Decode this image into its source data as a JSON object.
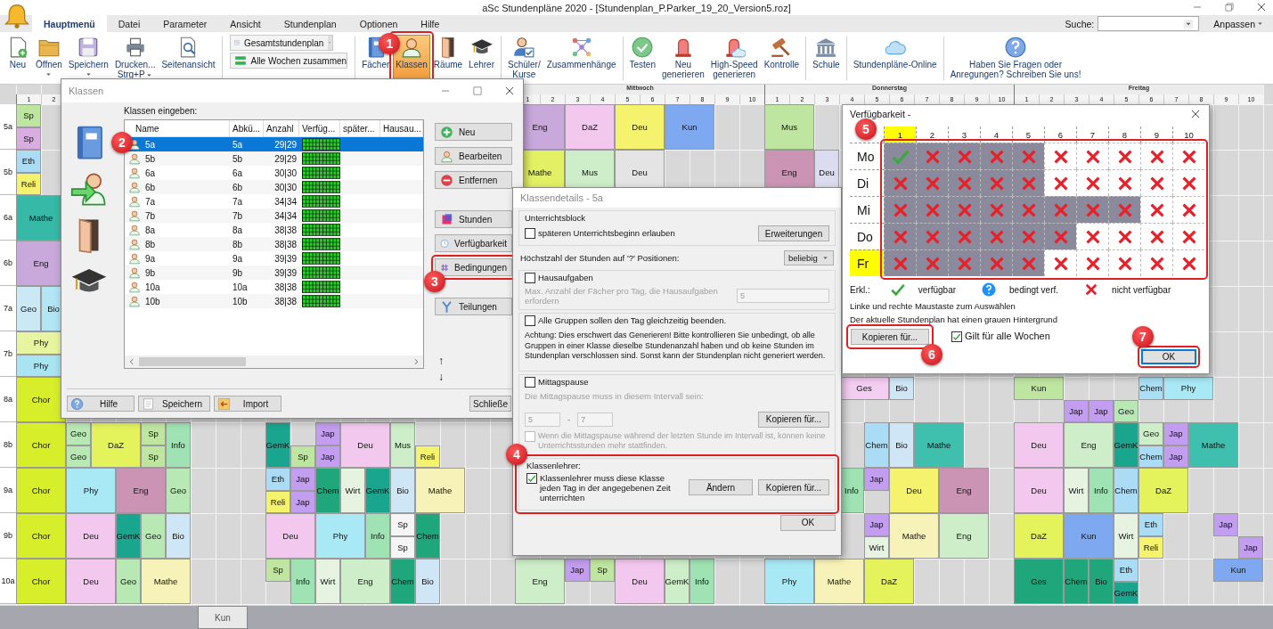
{
  "window": {
    "title": "aSc Stundenpläne 2020  - [Stundenplan_P.Parker_19_20_Version5.roz]"
  },
  "menu_tabs": [
    {
      "label": "Hauptmenü",
      "selected": true
    },
    {
      "label": "Datei",
      "selected": false
    },
    {
      "label": "Parameter",
      "selected": false
    },
    {
      "label": "Ansicht",
      "selected": false
    },
    {
      "label": "Stundenplan",
      "selected": false
    },
    {
      "label": "Optionen",
      "selected": false
    },
    {
      "label": "Hilfe",
      "selected": false
    }
  ],
  "search": {
    "label": "Suche:"
  },
  "customize": {
    "label": "Anpassen"
  },
  "ribbon": [
    {
      "items": [
        {
          "kind": "button",
          "label": "Neu",
          "selected": false,
          "has_dropdown": false
        },
        {
          "kind": "button",
          "label": "Öffnen",
          "selected": false,
          "has_dropdown": true
        },
        {
          "kind": "button",
          "label": "Speichern",
          "selected": false,
          "has_dropdown": true
        },
        {
          "kind": "button",
          "label": "Drucken...\nStrg+P",
          "selected": false,
          "has_dropdown": true
        },
        {
          "kind": "button",
          "label": "Seitenansicht",
          "selected": false,
          "has_dropdown": false
        }
      ]
    },
    {
      "items": [
        {
          "kind": "dropdown",
          "label": "Gesamtstundenplan",
          "selected": false,
          "has_dropdown": true
        },
        {
          "kind": "wide",
          "label": "Alle Wochen zusammen",
          "selected": false,
          "has_dropdown": false
        }
      ]
    },
    {
      "items": [
        {
          "kind": "button",
          "label": "Fächer",
          "selected": false,
          "has_dropdown": false
        },
        {
          "kind": "button",
          "label": "Klassen",
          "selected": true,
          "has_dropdown": false,
          "callout": {
            "label": "1",
            "framed": true
          }
        },
        {
          "kind": "button",
          "label": "Räume",
          "selected": false,
          "has_dropdown": false
        },
        {
          "kind": "button",
          "label": "Lehrer",
          "selected": false,
          "has_dropdown": false
        }
      ]
    },
    {
      "items": [
        {
          "kind": "button",
          "label": "Schüler/\nKurse",
          "selected": false,
          "has_dropdown": false
        },
        {
          "kind": "button",
          "label": "Zusammenhänge",
          "selected": false,
          "has_dropdown": false
        }
      ]
    },
    {
      "items": [
        {
          "kind": "button",
          "label": "Testen",
          "selected": false,
          "has_dropdown": false
        },
        {
          "kind": "button",
          "label": "Neu\ngenerieren",
          "selected": false,
          "has_dropdown": false
        },
        {
          "kind": "button",
          "label": "High-Speed\ngenerieren",
          "selected": false,
          "has_dropdown": false
        },
        {
          "kind": "button",
          "label": "Kontrolle",
          "selected": false,
          "has_dropdown": false
        }
      ]
    },
    {
      "items": [
        {
          "kind": "button",
          "label": "Schule",
          "selected": false,
          "has_dropdown": false
        }
      ]
    },
    {
      "items": [
        {
          "kind": "button",
          "label": "Stundenpläne-Online",
          "selected": false,
          "has_dropdown": false
        }
      ]
    },
    {
      "items": [
        {
          "kind": "button",
          "label": "Haben Sie Fragen oder\nAnregungen? Schreiben Sie uns!",
          "selected": false,
          "has_dropdown": false
        }
      ]
    }
  ],
  "timetable": {
    "days": [
      {
        "kind": "shown",
        "periods": [
          "1",
          "2"
        ]
      },
      {
        "kind": "covered"
      },
      {
        "kind": "shown",
        "name": "Mittwoch",
        "periods": [
          "1",
          "2",
          "3",
          "4",
          "5",
          "6",
          "7",
          "8",
          "9",
          "10"
        ]
      },
      {
        "kind": "shown",
        "name": "Donnerstag",
        "periods": [
          "1",
          "2",
          "3",
          "4",
          "5",
          "6",
          "7",
          "8",
          "9",
          "10"
        ]
      },
      {
        "kind": "shown",
        "name": "Freitag",
        "periods": [
          "1",
          "2",
          "3",
          "4",
          "5",
          "6",
          "7",
          "8",
          "9",
          "10"
        ]
      }
    ],
    "rows": [
      {
        "label": "5a",
        "cells": [
          {
            "kind": "split",
            "top": {
              "subject": "Sp",
              "color": "#bfe6a0"
            },
            "bottom": {
              "subject": "Sp",
              "color": "#d8aee0"
            }
          },
          "",
          "",
          "",
          "",
          "",
          "",
          "",
          "",
          "",
          "",
          "",
          "",
          "",
          "",
          "",
          "",
          "",
          "",
          "",
          {
            "kind": "double",
            "subject": "Eng",
            "color": "#c9a8dc"
          },
          "",
          {
            "kind": "double",
            "subject": "DaZ",
            "color": "#f3c8ee"
          },
          "",
          {
            "kind": "double",
            "subject": "Deu",
            "color": "#f5f26e"
          },
          "",
          {
            "kind": "double",
            "subject": "Kun",
            "color": "#7ea8ef"
          },
          "",
          "",
          "",
          {
            "kind": "double",
            "subject": "Mus",
            "color": "#bfe6a1"
          }
        ]
      },
      {
        "label": "5b",
        "cells": [
          {
            "kind": "split",
            "top": {
              "subject": "Eth",
              "color": "#aadcf5"
            },
            "bottom": {
              "subject": "Reli",
              "color": "#f5f26e"
            }
          },
          "",
          "",
          "",
          "",
          "",
          "",
          "",
          "",
          "",
          "",
          "",
          "",
          "",
          "",
          "",
          "",
          "",
          "",
          "",
          {
            "kind": "double",
            "subject": "Mathe",
            "color": "#e2f064"
          },
          "",
          {
            "kind": "double",
            "subject": "Mus",
            "color": "#cdeec8"
          },
          "",
          {
            "kind": "double",
            "subject": "Deu",
            "color": "#e4e4e4"
          },
          "",
          "",
          "",
          "",
          "",
          {
            "kind": "double",
            "subject": "Eng",
            "color": "#cc94b4"
          },
          "",
          {
            "kind": "single",
            "subject": "Deu",
            "color": "#dcdcf0"
          }
        ]
      },
      {
        "label": "6a",
        "cells": [
          {
            "kind": "double",
            "subject": "Mathe",
            "color": "#36b9a6"
          }
        ]
      },
      {
        "label": "6b",
        "cells": [
          {
            "kind": "double",
            "subject": "Eng",
            "color": "#c9a8dc"
          }
        ]
      },
      {
        "label": "7a",
        "cells": [
          {
            "kind": "single",
            "subject": "Geo",
            "color": "#cbe9f5"
          },
          {
            "kind": "single",
            "subject": "Bio",
            "color": "#b2e6f5"
          }
        ]
      },
      {
        "label": "7b",
        "cells": [
          {
            "kind": "double_split",
            "top": {
              "subject": "Phy",
              "color": "#e8f5a0"
            },
            "bottom": {
              "subject": "Phy",
              "color": "#a8e4f2"
            }
          }
        ]
      },
      {
        "label": "8a",
        "cells": [
          {
            "kind": "double",
            "subject": "Chor",
            "color": "#d6ef2a"
          },
          "",
          "",
          "",
          "",
          "",
          "",
          "",
          "",
          "",
          "",
          "",
          "",
          "",
          "",
          "",
          "",
          "",
          "",
          "",
          "",
          "",
          "",
          "",
          "",
          "",
          "",
          "",
          "",
          "",
          "",
          "",
          "",
          {
            "kind": "double_split",
            "top": {
              "subject": "Ges",
              "color": "#f4cdf2"
            }
          },
          "",
          {
            "kind": "split",
            "top": {
              "subject": "Bio",
              "color": "#cfe6f7"
            }
          },
          "",
          "",
          "",
          "",
          {
            "kind": "double_split",
            "top": {
              "subject": "Kun",
              "color": "#bfe6a0"
            }
          },
          "",
          {
            "kind": "split",
            "bottom": {
              "subject": "Jap",
              "color": "#c39df0"
            }
          },
          {
            "kind": "split",
            "bottom": {
              "subject": "Jap",
              "color": "#c39df0"
            }
          },
          {
            "kind": "split",
            "bottom": {
              "subject": "Geo",
              "color": "#b8e9b5"
            }
          },
          {
            "kind": "split",
            "top": {
              "subject": "Chem",
              "color": "#a9e0f5"
            }
          },
          {
            "kind": "double_split",
            "top": {
              "subject": "Phy",
              "color": "#a9e8f5"
            }
          }
        ]
      },
      {
        "label": "8b",
        "cells": [
          {
            "kind": "double",
            "subject": "Chor",
            "color": "#d6ef2a"
          },
          "",
          {
            "kind": "split",
            "top": {
              "subject": "Geo",
              "color": "#b8e9b5"
            },
            "bottom": {
              "subject": "Geo",
              "color": "#b8e9b5"
            }
          },
          {
            "kind": "double",
            "subject": "DaZ",
            "color": "#e4f25c"
          },
          "",
          {
            "kind": "split",
            "top": {
              "subject": "Sp",
              "color": "#bfe6a0"
            },
            "bottom": {
              "subject": "Sp",
              "color": "#bfe6a0"
            }
          },
          {
            "kind": "single",
            "subject": "Info",
            "color": "#9fe3b4"
          },
          "",
          "",
          "",
          {
            "kind": "single",
            "subject": "GemK",
            "color": "#1aa58e"
          },
          {
            "kind": "split",
            "bottom": {
              "subject": "Sp",
              "color": "#bfe6a0"
            }
          },
          {
            "kind": "split",
            "top": {
              "subject": "Jap",
              "color": "#c39df0"
            },
            "bottom": {
              "subject": "Jap",
              "color": "#c39df0"
            }
          },
          {
            "kind": "double",
            "subject": "Deu",
            "color": "#f3c8ee"
          },
          "",
          {
            "kind": "single",
            "subject": "Mus",
            "color": "#cdeec8"
          },
          {
            "kind": "split",
            "bottom": {
              "subject": "Reli",
              "color": "#f5f26e"
            }
          },
          "",
          "",
          "",
          "",
          "",
          "",
          "",
          "",
          "",
          "",
          "",
          "",
          "",
          "",
          "",
          "",
          "",
          {
            "kind": "single",
            "subject": "Chem",
            "color": "#aadcf5"
          },
          {
            "kind": "single",
            "subject": "Bio",
            "color": "#cfe6f7"
          },
          {
            "kind": "double",
            "subject": "Mathe",
            "color": "#3fbfae"
          },
          "",
          "",
          "",
          {
            "kind": "double",
            "subject": "Deu",
            "color": "#f3c8ee"
          },
          "",
          {
            "kind": "double",
            "subject": "Eng",
            "color": "#cdeec8"
          },
          "",
          {
            "kind": "single",
            "subject": "GemK",
            "color": "#1aa58e"
          },
          {
            "kind": "split",
            "top": {
              "subject": "Geo",
              "color": "#cdeec8"
            },
            "bottom": {
              "subject": "Chem",
              "color": "#aadcf5"
            }
          },
          {
            "kind": "split",
            "top": {
              "subject": "Jap",
              "color": "#c39df0"
            },
            "bottom": {
              "subject": "Jap",
              "color": "#c39df0"
            }
          },
          {
            "kind": "double",
            "subject": "Mathe",
            "color": "#3fbfae"
          }
        ]
      },
      {
        "label": "9a",
        "cells": [
          {
            "kind": "double",
            "subject": "Chor",
            "color": "#d6ef2a"
          },
          "",
          {
            "kind": "double",
            "subject": "Phy",
            "color": "#a9e8f5"
          },
          "",
          {
            "kind": "double",
            "subject": "Eng",
            "color": "#cc94b4"
          },
          "",
          {
            "kind": "single",
            "subject": "Geo",
            "color": "#b8e9b5"
          },
          "",
          "",
          "",
          {
            "kind": "split",
            "top": {
              "subject": "Eth",
              "color": "#aadcf5"
            },
            "bottom": {
              "subject": "Reli",
              "color": "#f5f26e"
            }
          },
          {
            "kind": "split",
            "top": {
              "subject": "Jap",
              "color": "#c39df0"
            },
            "bottom": {
              "subject": "Jap",
              "color": "#c39df0"
            }
          },
          {
            "kind": "single",
            "subject": "Chem",
            "color": "#1fa67a"
          },
          {
            "kind": "single",
            "subject": "Wirt",
            "color": "#e5f3e0"
          },
          {
            "kind": "single",
            "subject": "GemK",
            "color": "#1aa58e"
          },
          {
            "kind": "single",
            "subject": "Bio",
            "color": "#cfe6f7"
          },
          {
            "kind": "double",
            "subject": "Mathe",
            "color": "#f7f3b8"
          },
          "",
          "",
          "",
          "",
          "",
          "",
          "",
          "",
          "",
          "",
          "",
          "",
          "",
          "",
          "",
          "",
          {
            "kind": "single",
            "subject": "Info",
            "color": "#9fe3b4"
          },
          {
            "kind": "split",
            "top": {
              "subject": "Jap",
              "color": "#c39df0"
            }
          },
          {
            "kind": "double",
            "subject": "Deu",
            "color": "#f5f26e"
          },
          "",
          {
            "kind": "double",
            "subject": "Eng",
            "color": "#cc94b4"
          },
          "",
          "",
          {
            "kind": "double",
            "subject": "Deu",
            "color": "#f3c8ee"
          },
          "",
          {
            "kind": "single",
            "subject": "Wirt",
            "color": "#e5f3e0"
          },
          {
            "kind": "single",
            "subject": "Info",
            "color": "#9fe3b4"
          },
          {
            "kind": "single",
            "subject": "Chem",
            "color": "#aadcf5"
          },
          {
            "kind": "double",
            "subject": "DaZ",
            "color": "#e4f25c"
          }
        ]
      },
      {
        "label": "9b",
        "cells": [
          {
            "kind": "double",
            "subject": "Chor",
            "color": "#d6ef2a"
          },
          "",
          {
            "kind": "double",
            "subject": "Deu",
            "color": "#f3c8ee"
          },
          "",
          {
            "kind": "single",
            "subject": "GemK",
            "color": "#1aa58e"
          },
          {
            "kind": "single",
            "subject": "Geo",
            "color": "#b8e9b5"
          },
          {
            "kind": "single",
            "subject": "Bio",
            "color": "#cfe6f7"
          },
          "",
          "",
          "",
          {
            "kind": "double",
            "subject": "Deu",
            "color": "#f3c8ee"
          },
          "",
          {
            "kind": "double",
            "subject": "Phy",
            "color": "#a9e8f5"
          },
          "",
          {
            "kind": "single",
            "subject": "Info",
            "color": "#9fe3b4"
          },
          {
            "kind": "split",
            "top": {
              "subject": "Sp",
              "color": "#f5f5f5"
            },
            "bottom": {
              "subject": "Sp",
              "color": "#f5f5f5"
            }
          },
          {
            "kind": "single",
            "subject": "Chem",
            "color": "#1fa67a"
          },
          "",
          "",
          "",
          "",
          "",
          "",
          "",
          "",
          "",
          "",
          "",
          "",
          "",
          "",
          "",
          "",
          "",
          {
            "kind": "split",
            "top": {
              "subject": "Jap",
              "color": "#c39df0"
            },
            "bottom": {
              "subject": "Wirt",
              "color": "#e5f3e0"
            }
          },
          {
            "kind": "double",
            "subject": "Mathe",
            "color": "#f7f3b8"
          },
          "",
          {
            "kind": "double",
            "subject": "Eng",
            "color": "#cdeec8"
          },
          "",
          "",
          {
            "kind": "double",
            "subject": "DaZ",
            "color": "#e4f25c"
          },
          "",
          {
            "kind": "double",
            "subject": "Kun",
            "color": "#7ea8ef"
          },
          "",
          {
            "kind": "single",
            "subject": "Wirt",
            "color": "#e5f3e0"
          },
          {
            "kind": "split",
            "top": {
              "subject": "Eth",
              "color": "#aadcf5"
            },
            "bottom": {
              "subject": "Reli",
              "color": "#f5f26e"
            }
          },
          "",
          "",
          {
            "kind": "split",
            "top": {
              "subject": "Jap",
              "color": "#c39df0"
            }
          },
          {
            "kind": "split",
            "bottom": {
              "subject": "Jap",
              "color": "#c39df0"
            }
          }
        ]
      },
      {
        "label": "10a",
        "cells": [
          {
            "kind": "double",
            "subject": "Chor",
            "color": "#d6ef2a"
          },
          "",
          {
            "kind": "double",
            "subject": "Deu",
            "color": "#f3c8ee"
          },
          "",
          {
            "kind": "single",
            "subject": "Geo",
            "color": "#b8e9b5"
          },
          {
            "kind": "double",
            "subject": "Mathe",
            "color": "#f7f3b8"
          },
          "",
          "",
          "",
          "",
          {
            "kind": "split",
            "top": {
              "subject": "Sp",
              "color": "#bfe6a0"
            }
          },
          {
            "kind": "single",
            "subject": "Info",
            "color": "#9fe3b4"
          },
          {
            "kind": "single",
            "subject": "Wirt",
            "color": "#e5f3e0"
          },
          {
            "kind": "double",
            "subject": "Eng",
            "color": "#cdeec8"
          },
          "",
          {
            "kind": "single",
            "subject": "Chem",
            "color": "#1fa67a"
          },
          {
            "kind": "single",
            "subject": "Bio",
            "color": "#cfe6f7"
          },
          "",
          "",
          "",
          {
            "kind": "double",
            "subject": "Eng",
            "color": "#cdeec8"
          },
          "",
          {
            "kind": "split",
            "top": {
              "subject": "Jap",
              "color": "#c39df0"
            }
          },
          {
            "kind": "split",
            "top": {
              "subject": "Sp",
              "color": "#bfe6a0"
            }
          },
          {
            "kind": "double",
            "subject": "Deu",
            "color": "#f3c8ee"
          },
          "",
          {
            "kind": "single",
            "subject": "GemK",
            "color": "#cdeec8"
          },
          {
            "kind": "single",
            "subject": "Info",
            "color": "#9fe3b4"
          },
          "",
          "",
          {
            "kind": "double",
            "subject": "Phy",
            "color": "#a9e8f5"
          },
          "",
          {
            "kind": "double",
            "subject": "Mathe",
            "color": "#f7f3b8"
          },
          "",
          {
            "kind": "double",
            "subject": "DaZ",
            "color": "#e4f25c"
          },
          "",
          "",
          "",
          "",
          "",
          {
            "kind": "double",
            "subject": "Ges",
            "color": "#1fa67a"
          },
          "",
          {
            "kind": "single",
            "subject": "Chem",
            "color": "#1fa67a"
          },
          {
            "kind": "single",
            "subject": "Bio",
            "color": "#1fa67a"
          },
          {
            "kind": "split",
            "top": {
              "subject": "Eth",
              "color": "#aadcf5"
            },
            "bottom": {
              "subject": "GemK",
              "color": "#1aa58e"
            }
          },
          "",
          "",
          "",
          {
            "kind": "double_split",
            "top": {
              "subject": "Kun",
              "color": "#7ea8ef"
            }
          }
        ]
      }
    ]
  },
  "classes_dialog": {
    "title": "Klassen",
    "prompt": "Klassen eingeben:",
    "columns": [
      "Name",
      "Abkü...",
      "Anzahl",
      "Verfüg...",
      "später...",
      "Hausau..."
    ],
    "callout": {
      "label": "2",
      "framed": false
    },
    "rows": [
      {
        "name": "5a",
        "abbr": "5a",
        "count": "29|29",
        "selected": true
      },
      {
        "name": "5b",
        "abbr": "5b",
        "count": "29|29",
        "selected": false
      },
      {
        "name": "6a",
        "abbr": "6a",
        "count": "30|30",
        "selected": false
      },
      {
        "name": "6b",
        "abbr": "6b",
        "count": "30|30",
        "selected": false
      },
      {
        "name": "7a",
        "abbr": "7a",
        "count": "34|34",
        "selected": false
      },
      {
        "name": "7b",
        "abbr": "7b",
        "count": "34|34",
        "selected": false
      },
      {
        "name": "8a",
        "abbr": "8a",
        "count": "38|38",
        "selected": false
      },
      {
        "name": "8b",
        "abbr": "8b",
        "count": "38|38",
        "selected": false
      },
      {
        "name": "9a",
        "abbr": "9a",
        "count": "39|39",
        "selected": false
      },
      {
        "name": "9b",
        "abbr": "9b",
        "count": "39|39",
        "selected": false
      },
      {
        "name": "10a",
        "abbr": "10a",
        "count": "38|38",
        "selected": false
      },
      {
        "name": "10b",
        "abbr": "10b",
        "count": "38|38",
        "selected": false
      }
    ],
    "button_groups": [
      [
        {
          "label": "Neu"
        },
        {
          "label": "Bearbeiten"
        },
        {
          "label": "Entfernen"
        }
      ],
      [
        {
          "label": "Stunden"
        },
        {
          "label": "Verfügbarkeit"
        },
        {
          "label": "Bedingungen",
          "callout": {
            "label": "3",
            "framed": true
          }
        }
      ],
      [
        {
          "label": "Teilungen"
        }
      ]
    ],
    "move_buttons": [
      "↑",
      "↓"
    ],
    "footer_buttons": [
      "Hilfe",
      "Speichern",
      "Import"
    ],
    "close_button": "Schließe"
  },
  "details_dialog": {
    "title": "Klassendetails - 5a",
    "block": {
      "legend": "Unterrichtsblock",
      "checkbox": {
        "label": "späteren Unterrichtsbeginn erlauben",
        "checked": false
      },
      "button": "Erweiterungen"
    },
    "max_hours": {
      "label": "Höchstzahl der Stunden auf '?' Positionen:",
      "value": "beliebig"
    },
    "homework": {
      "checkbox": {
        "label": "Hausaufgaben",
        "checked": false
      },
      "hint": "Max. Anzahl der Fächer pro Tag, die  Hausaufgaben erfordern",
      "value": "5",
      "disabled": true
    },
    "groups_end": {
      "checkbox": {
        "label": "Alle Gruppen sollen den Tag gleichzeitig beenden.",
        "checked": false
      },
      "note": "Achtung: Dies erschwert das Generieren! Bitte kontrollieren Sie unbedingt, ob alle Gruppen in einer Klasse dieselbe Stundenanzahl haben und ob keine Stunden im Stundenplan verschlossen sind. Sonst kann der Stundenplan nicht generiert werden."
    },
    "lunch": {
      "checkbox": {
        "label": "Mittagspause",
        "checked": false
      },
      "hint": "Die Mittagspause muss in diesem Intervall sein:",
      "from": "5",
      "separator": "-",
      "to": "7",
      "button": "Kopieren für...",
      "disabled": true,
      "sub_checkbox": {
        "label": "Wenn die Mittagspause während der letzten Stunde im Intervall ist, können keine Unterrichtsstunden mehr stattfinden.",
        "checked": false
      }
    },
    "class_teacher": {
      "legend": "Klassenlehrer:",
      "checkbox": {
        "label": "Klassenlehrer muss diese Klasse jeden Tag in der angegebenen Zeit unterrichten",
        "checked": true
      },
      "button": "Ändern",
      "copy_button": "Kopieren für...",
      "callout": {
        "label": "4",
        "framed": true
      }
    },
    "ok": "OK"
  },
  "availability_dialog": {
    "title": "Verfügbarkeit -",
    "callout": {
      "label": "5",
      "framed": true
    },
    "periods": [
      {
        "label": "1",
        "selected": true
      },
      {
        "label": "2",
        "selected": false
      },
      {
        "label": "3",
        "selected": false
      },
      {
        "label": "4",
        "selected": false
      },
      {
        "label": "5",
        "selected": false
      },
      {
        "label": "6",
        "selected": false
      },
      {
        "label": "7",
        "selected": false
      },
      {
        "label": "8",
        "selected": false
      },
      {
        "label": "9",
        "selected": false
      },
      {
        "label": "10",
        "selected": false
      }
    ],
    "days": [
      {
        "label": "Mo",
        "selected": false,
        "slots": [
          {
            "kind": "available",
            "current": true
          },
          {
            "kind": "unavailable",
            "current": true
          },
          {
            "kind": "unavailable",
            "current": true
          },
          {
            "kind": "unavailable",
            "current": true
          },
          {
            "kind": "unavailable",
            "current": true
          },
          {
            "kind": "unavailable",
            "current": false
          },
          {
            "kind": "unavailable",
            "current": false
          },
          {
            "kind": "unavailable",
            "current": false
          },
          {
            "kind": "unavailable",
            "current": false
          },
          {
            "kind": "unavailable",
            "current": false
          }
        ]
      },
      {
        "label": "Di",
        "selected": false,
        "slots": [
          {
            "kind": "unavailable",
            "current": true
          },
          {
            "kind": "unavailable",
            "current": true
          },
          {
            "kind": "unavailable",
            "current": true
          },
          {
            "kind": "unavailable",
            "current": true
          },
          {
            "kind": "unavailable",
            "current": true
          },
          {
            "kind": "unavailable",
            "current": false
          },
          {
            "kind": "unavailable",
            "current": false
          },
          {
            "kind": "unavailable",
            "current": false
          },
          {
            "kind": "unavailable",
            "current": false
          },
          {
            "kind": "unavailable",
            "current": false
          }
        ]
      },
      {
        "label": "Mi",
        "selected": false,
        "slots": [
          {
            "kind": "unavailable",
            "current": true
          },
          {
            "kind": "unavailable",
            "current": true
          },
          {
            "kind": "unavailable",
            "current": true
          },
          {
            "kind": "unavailable",
            "current": true
          },
          {
            "kind": "unavailable",
            "current": true
          },
          {
            "kind": "unavailable",
            "current": true
          },
          {
            "kind": "unavailable",
            "current": true
          },
          {
            "kind": "unavailable",
            "current": true
          },
          {
            "kind": "unavailable",
            "current": false
          },
          {
            "kind": "unavailable",
            "current": false
          }
        ]
      },
      {
        "label": "Do",
        "selected": false,
        "slots": [
          {
            "kind": "unavailable",
            "current": true
          },
          {
            "kind": "unavailable",
            "current": true
          },
          {
            "kind": "unavailable",
            "current": true
          },
          {
            "kind": "unavailable",
            "current": true
          },
          {
            "kind": "unavailable",
            "current": true
          },
          {
            "kind": "unavailable",
            "current": true
          },
          {
            "kind": "unavailable",
            "current": false
          },
          {
            "kind": "unavailable",
            "current": false
          },
          {
            "kind": "unavailable",
            "current": false
          },
          {
            "kind": "unavailable",
            "current": false
          }
        ]
      },
      {
        "label": "Fr",
        "selected": true,
        "slots": [
          {
            "kind": "unavailable",
            "current": true
          },
          {
            "kind": "unavailable",
            "current": true
          },
          {
            "kind": "unavailable",
            "current": true
          },
          {
            "kind": "unavailable",
            "current": true
          },
          {
            "kind": "unavailable",
            "current": true
          },
          {
            "kind": "unavailable",
            "current": false
          },
          {
            "kind": "unavailable",
            "current": false
          },
          {
            "kind": "unavailable",
            "current": false
          },
          {
            "kind": "unavailable",
            "current": false
          },
          {
            "kind": "unavailable",
            "current": false
          }
        ]
      }
    ],
    "legend": {
      "label": "Erkl.:",
      "items": [
        {
          "kind": "available",
          "label": "verfügbar"
        },
        {
          "kind": "conditional",
          "label": "bedingt verf."
        },
        {
          "kind": "unavailable",
          "label": "nicht verfügbar"
        }
      ]
    },
    "hints": [
      "Linke und rechte Maustaste zum Auswählen",
      "Der aktuelle Stundenplan hat einen grauen Hintergrund"
    ],
    "copy_button": {
      "label": "Kopieren für...",
      "callout": {
        "label": "6",
        "framed": true
      }
    },
    "all_weeks": {
      "label": "Gilt für alle Wochen",
      "checked": true
    },
    "ok": {
      "label": "OK",
      "callout": {
        "label": "7",
        "framed": true
      }
    }
  },
  "bottom_tabs": [
    "Kun"
  ]
}
